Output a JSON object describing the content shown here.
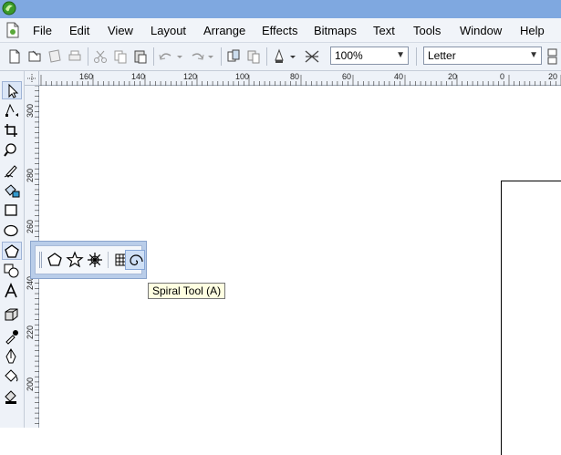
{
  "menu": {
    "items": [
      {
        "label": "File"
      },
      {
        "label": "Edit"
      },
      {
        "label": "View"
      },
      {
        "label": "Layout"
      },
      {
        "label": "Arrange"
      },
      {
        "label": "Effects"
      },
      {
        "label": "Bitmaps"
      },
      {
        "label": "Text"
      },
      {
        "label": "Tools"
      },
      {
        "label": "Window"
      },
      {
        "label": "Help"
      }
    ]
  },
  "toolbar": {
    "zoom_value": "100%",
    "page_size_value": "Letter"
  },
  "rulers": {
    "horizontal_labels": [
      "160",
      "140",
      "120",
      "100",
      "80",
      "60",
      "40",
      "20",
      "0",
      "20"
    ],
    "vertical_labels": [
      "300",
      "280",
      "260",
      "240",
      "220",
      "200"
    ]
  },
  "flyout": {
    "tools": [
      "polygon-tool",
      "star-tool",
      "complex-star-tool",
      "graph-paper-tool",
      "spiral-tool"
    ],
    "active_tool": "spiral-tool"
  },
  "tooltip": {
    "text": "Spiral Tool (A)"
  },
  "colors": {
    "titlebar": "#7fa8e0",
    "toolbar_bg": "#eef2f8",
    "flyout_border": "#b9cde9",
    "tooltip_bg": "#ffffe1"
  }
}
